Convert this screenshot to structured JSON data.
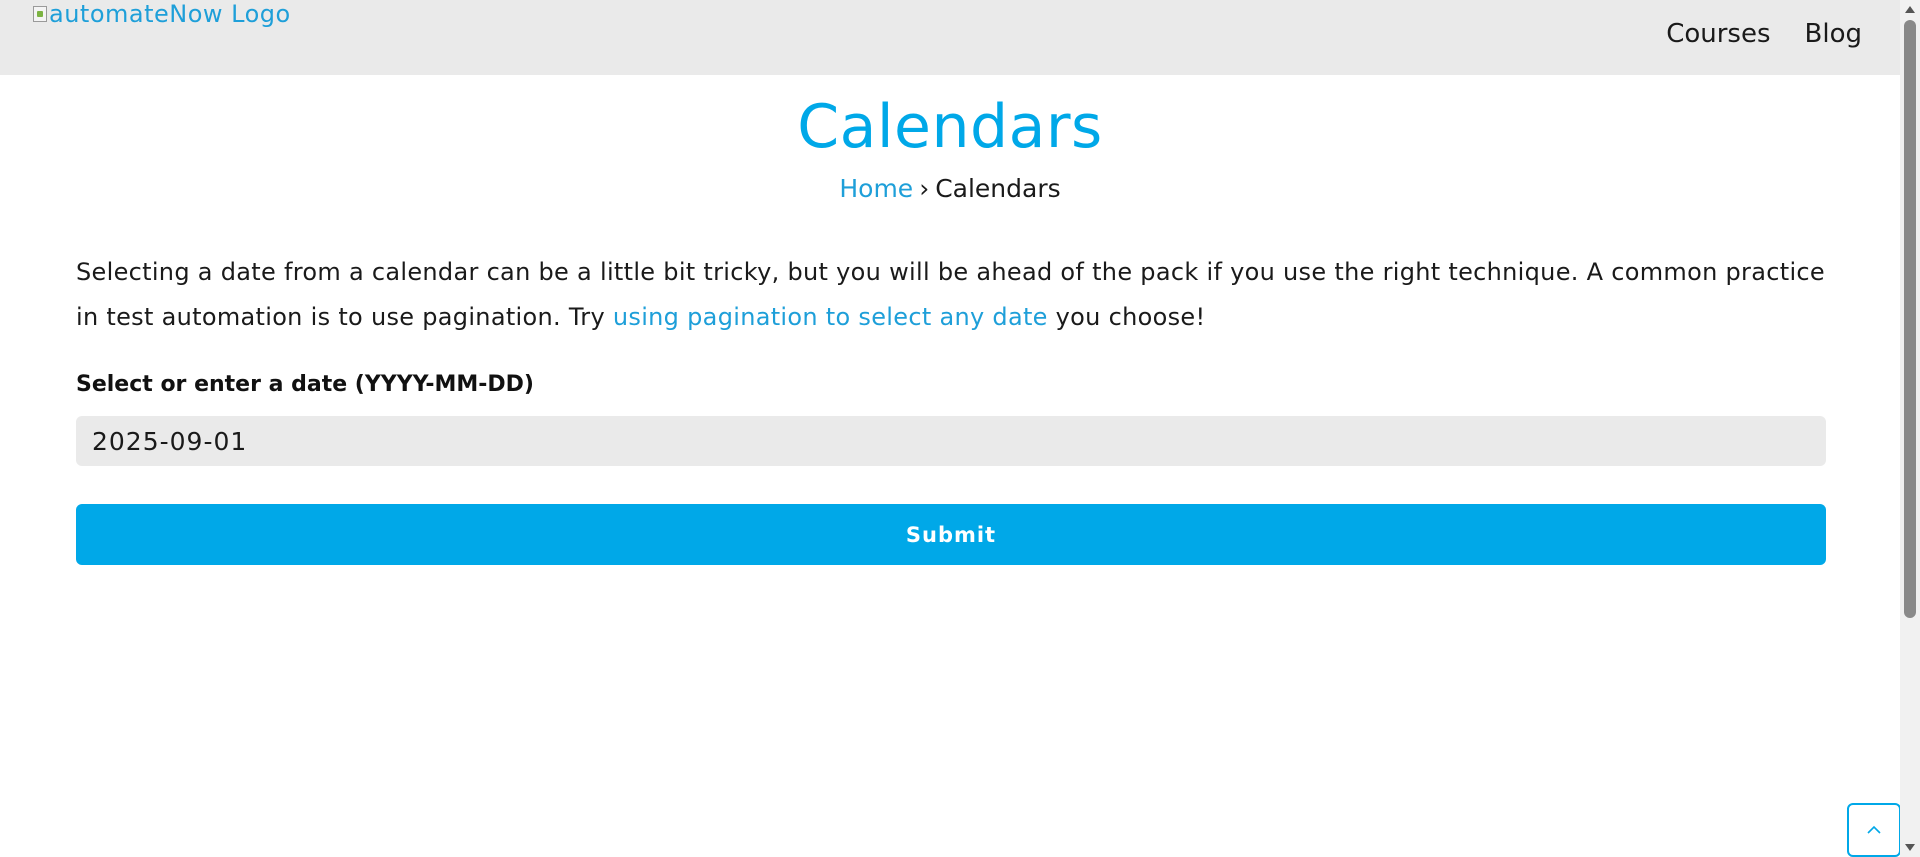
{
  "header": {
    "logo_alt": "automateNow Logo",
    "nav": [
      {
        "label": "Courses"
      },
      {
        "label": "Blog"
      }
    ]
  },
  "page": {
    "title": "Calendars",
    "breadcrumb": {
      "home": "Home",
      "separator": "›",
      "current": "Calendars"
    }
  },
  "intro": {
    "text_before": "Selecting a date from a calendar can be a little bit tricky, but you will be ahead of the pack if you use the right technique. A common practice in test automation is to use pagination. Try ",
    "link": "using pagination to select any date",
    "text_after": " you choose!"
  },
  "form": {
    "label": "Select or enter a date (YYYY-MM-DD)",
    "date_value": "2025-09-01",
    "submit_label": "Submit"
  },
  "icons": {
    "scroll_top": "chevron-up-icon",
    "broken_image": "broken-image-icon"
  },
  "colors": {
    "accent": "#00a8e8",
    "link": "#1e9fd9",
    "header_bg": "#eaeaea",
    "input_bg": "#eaeaea"
  }
}
